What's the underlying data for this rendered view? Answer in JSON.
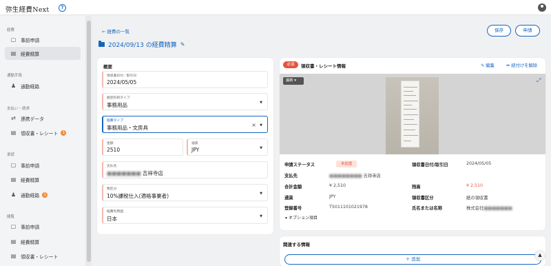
{
  "app": {
    "title": "弥生経費Next",
    "help_icon": "question-circle-icon",
    "avatar_icon": "user-avatar-icon"
  },
  "sidebar": {
    "sections": [
      {
        "label": "経費",
        "items": [
          {
            "label": "事前申請",
            "icon": "document-icon"
          },
          {
            "label": "経費精算",
            "icon": "receipt-icon",
            "active": true
          }
        ]
      },
      {
        "label": "通勤手段",
        "items": [
          {
            "label": "通勤経路",
            "icon": "route-icon"
          }
        ]
      },
      {
        "label": "支払い・請求",
        "items": [
          {
            "label": "連携データ",
            "icon": "data-icon"
          },
          {
            "label": "領収書・レシート",
            "icon": "receipt-icon",
            "badge": "1"
          }
        ]
      },
      {
        "label": "承認",
        "items": [
          {
            "label": "事前申請",
            "icon": "document-icon"
          },
          {
            "label": "経費精算",
            "icon": "receipt-icon"
          },
          {
            "label": "通勤経路",
            "icon": "route-icon",
            "badge": "1"
          }
        ]
      },
      {
        "label": "閲覧",
        "items": [
          {
            "label": "事前申請",
            "icon": "document-icon"
          },
          {
            "label": "経費精算",
            "icon": "receipt-icon"
          },
          {
            "label": "領収書・レシート",
            "icon": "receipt-icon"
          }
        ]
      }
    ]
  },
  "main": {
    "back_label": "経費の一覧",
    "page_title": "2024/09/13 の経費精算",
    "save_label": "保存",
    "apply_label": "申請"
  },
  "summary": {
    "title": "概要",
    "date": {
      "label": "領収書日付／取引日",
      "value": "2024/05/05"
    },
    "expense_type": {
      "label": "勘定科目タイプ",
      "value": "事務用品"
    },
    "category": {
      "label": "経費タイプ",
      "value": "事務用品・文房具"
    },
    "amount": {
      "label": "金額",
      "value": "2510"
    },
    "currency": {
      "label": "通貨",
      "value": "JPY"
    },
    "payee": {
      "label": "支払先",
      "value": "吉祥寺店"
    },
    "tax": {
      "label": "税区分",
      "value": "10%課税仕入(適格事業者)"
    },
    "country": {
      "label": "経費利用国",
      "value": "日本"
    }
  },
  "receipt": {
    "required_label": "必須",
    "title": "領収書・レシート情報",
    "edit_label": "編集",
    "unlink_label": "紐付けを解除",
    "viewer_label": "最新",
    "rows": [
      {
        "k1": "申請ステータス",
        "v1": "未処理",
        "k2": "領収書日付/取引日",
        "v2": "2024/05/05"
      },
      {
        "k1": "支払先",
        "v1": "吉祥寺店",
        "k2": "",
        "v2": ""
      },
      {
        "k1": "合計金額",
        "v1": "¥ 2,510",
        "k2": "残高",
        "v2": "¥ 2,510"
      },
      {
        "k1": "通貨",
        "v1": "JPY",
        "k2": "領収書区分",
        "v2": "紙の領収書"
      },
      {
        "k1": "登録番号",
        "v1": "T5011101021978",
        "k2": "氏名または名称",
        "v2": "株式会社"
      }
    ],
    "options_label": "オプション項目"
  },
  "related": {
    "title": "関連する情報",
    "add_label": "＋ 追加"
  },
  "colors": {
    "accent": "#1565c0",
    "required": "#e5533d",
    "badge": "#f08c3a"
  }
}
